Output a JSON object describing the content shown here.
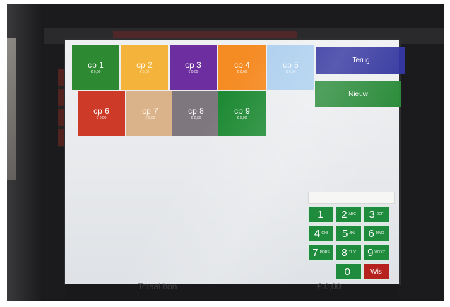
{
  "tiles": [
    {
      "name": "cp 1",
      "price": "€ 0,00",
      "color": "#2e8a32",
      "text": "#ffffff"
    },
    {
      "name": "cp 2",
      "price": "€ 0,00",
      "color": "#f4b33a",
      "text": "#fff7df"
    },
    {
      "name": "cp 3",
      "price": "€ 0,00",
      "color": "#6d2fa0",
      "text": "#ffffff"
    },
    {
      "name": "cp 4",
      "price": "€ 0,00",
      "color": "#f58b23",
      "text": "#ffffff"
    },
    {
      "name": "cp 5",
      "price": "€ 0,00",
      "color": "#aed0ef",
      "text": "#f6fbff"
    },
    {
      "name": "cp 6",
      "price": "€ 0,00",
      "color": "#cd3b28",
      "text": "#ffffff"
    },
    {
      "name": "cp 7",
      "price": "€ 0,00",
      "color": "#dbb38a",
      "text": "#fff6ea"
    },
    {
      "name": "cp 8",
      "price": "€ 0,00",
      "color": "#7e777d",
      "text": "#ffffff"
    },
    {
      "name": "cp 9",
      "price": "€ 0,00",
      "color": "#1e8a34",
      "text": "#ffffff"
    }
  ],
  "actions": {
    "back_label": "Terug",
    "back_color": "#34369f",
    "new_label": "Nieuw",
    "new_color": "#2a8b3a"
  },
  "keypad": {
    "keys": [
      {
        "digit": "1",
        "letters": ""
      },
      {
        "digit": "2",
        "letters": "ABC"
      },
      {
        "digit": "3",
        "letters": "DEF"
      },
      {
        "digit": "4",
        "letters": "GHI"
      },
      {
        "digit": "5",
        "letters": "JKL"
      },
      {
        "digit": "6",
        "letters": "MNO"
      },
      {
        "digit": "7",
        "letters": "PQRS"
      },
      {
        "digit": "8",
        "letters": "TUV"
      },
      {
        "digit": "9",
        "letters": "WXYZ"
      },
      {
        "digit": "0",
        "letters": "."
      }
    ],
    "clear_label": "Wis"
  },
  "footer": {
    "total_label": "Totaal bon",
    "total_value": "€ 0,00"
  }
}
